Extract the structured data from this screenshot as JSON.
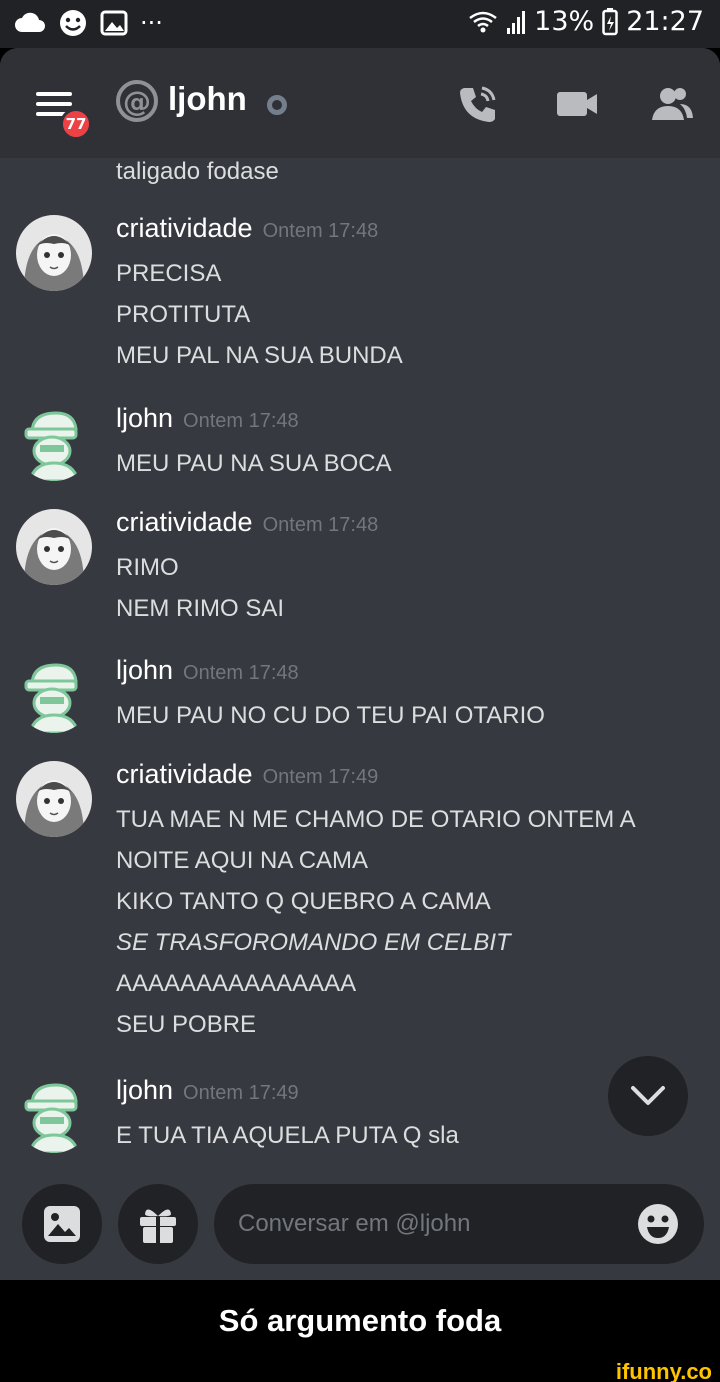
{
  "status_bar": {
    "dots": "···",
    "battery": "13%",
    "time": "21:27"
  },
  "header": {
    "badge_count": "77",
    "at_symbol": "@",
    "title": "ljohn"
  },
  "messages": {
    "continuation": "taligado fodase",
    "items": [
      {
        "author": "criatividade",
        "timestamp": "Ontem 17:48",
        "lines": [
          "PRECISA",
          "PROTITUTA",
          "MEU PAL NA SUA BUNDA"
        ]
      },
      {
        "author": "ljohn",
        "timestamp": "Ontem 17:48",
        "lines": [
          "MEU PAU NA SUA BOCA"
        ]
      },
      {
        "author": "criatividade",
        "timestamp": "Ontem 17:48",
        "lines": [
          "RIMO",
          "NEM RIMO SAI"
        ]
      },
      {
        "author": "ljohn",
        "timestamp": "Ontem 17:48",
        "lines": [
          "MEU PAU NO CU DO TEU PAI OTARIO"
        ]
      },
      {
        "author": "criatividade",
        "timestamp": "Ontem 17:49",
        "lines": [
          "TUA MAE N ME CHAMO DE OTARIO ONTEM A",
          "NOITE AQUI NA CAMA",
          "KIKO TANTO Q QUEBRO A CAMA",
          "SE TRASFOROMANDO EM CELBIT",
          "AAAAAAAAAAAAAAA",
          "SEU POBRE"
        ]
      },
      {
        "author": "ljohn",
        "timestamp": "Ontem 17:49",
        "lines": [
          "E TUA TIA AQUELA PUTA Q sla"
        ]
      }
    ]
  },
  "composer": {
    "placeholder": "Conversar em @ljohn"
  },
  "caption": "Só argumento foda",
  "watermark": "ifunny.co",
  "icons": [
    "cloud-icon",
    "smiley-icon",
    "gallery-icon",
    "wifi-icon",
    "signal-icon",
    "battery-icon",
    "menu-icon",
    "call-icon",
    "video-icon",
    "members-icon",
    "chevron-down-icon",
    "image-icon",
    "gift-icon",
    "emoji-icon"
  ],
  "colors": {
    "app_bg": "#36393f",
    "header_bg": "#2f3136",
    "badge": "#ed4245",
    "timestamp": "#72767d",
    "watermark": "#ffc400"
  }
}
